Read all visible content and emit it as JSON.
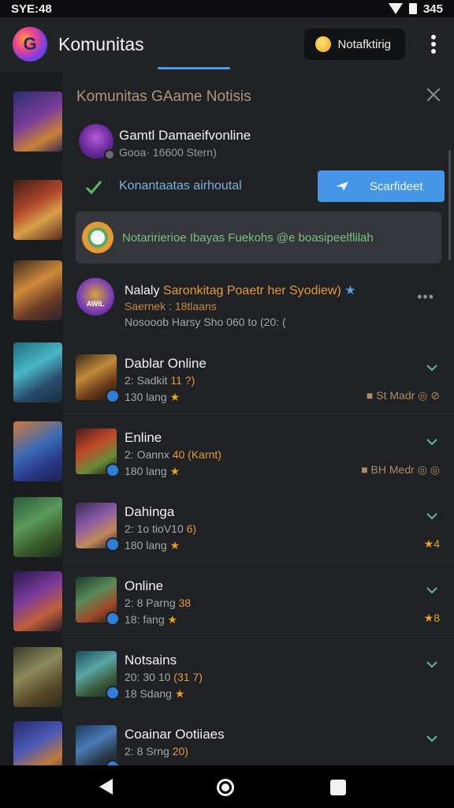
{
  "status_bar": {
    "time": "SYE:48",
    "right_time": "345"
  },
  "app_bar": {
    "title": "Komunitas",
    "notif_label": "Notafktirig"
  },
  "panel": {
    "title": "Komunitas GAame Notisis",
    "header": {
      "name": "Gamtl Damaeifvonline",
      "sub": "Gooa· 16600 Stern)"
    },
    "action": {
      "text": "Konantaatas airhoutal",
      "button": "Scarfideet"
    },
    "banner": {
      "text": "Notaririerioe Ibayas Fuekohs @e boasipeelflilah"
    },
    "featured": {
      "name_a": "Nalaly ",
      "name_b": "Saronkitag Poaetr her Syodiew)",
      "badge_text": "AWIL",
      "sub1": "Saernek : 18tlaans",
      "sub2": "Nosooob Harsy Sho 060 to (20: ("
    },
    "items": [
      {
        "name": "Dablar Online",
        "line2_a": "2: Sadkit ",
        "line2_b": "11 ?)",
        "line3_a": "130 lang ",
        "line3_b": "★",
        "right": "■ St Madr ◎ ⊘"
      },
      {
        "name": "Enline",
        "line2_a": "2: Oannx ",
        "line2_b": "40 (Karnt)",
        "line3_a": "180 lang ",
        "line3_b": "★",
        "right": "■ BH Medr ◎ ◎"
      },
      {
        "name": "Dahinga",
        "line2_a": "2: 1o tioV10 ",
        "line2_b": "6)",
        "line3_a": "180 lang ",
        "line3_b": "★",
        "right": "★4"
      },
      {
        "name": "Online",
        "line2_a": "2: 8 Parng ",
        "line2_b": "38",
        "line3_a": "18: fang ",
        "line3_b": "★",
        "right": "★8"
      },
      {
        "name": "Notsains",
        "line2_a": "20: 30 10 ",
        "line2_b": "(31 7)",
        "line3_a": "18 Sdang ",
        "line3_b": "★",
        "right": ""
      },
      {
        "name": "Coainar Ootiiaes",
        "line2_a": "2: 8 Srng ",
        "line2_b": "20)",
        "line3_a": "",
        "line3_b": "",
        "right": ""
      }
    ]
  },
  "colors": {
    "accent": "#4596e6",
    "background": "#202124",
    "highlight_orange": "#e39a3d",
    "banner_green": "#79c27a"
  },
  "icons": [
    "signal-icon",
    "battery-icon",
    "app-logo",
    "coin-icon",
    "kebab-menu-icon",
    "close-icon",
    "check-icon",
    "send-icon",
    "more-icon",
    "chevron-down-icon",
    "verified-icon",
    "back-icon",
    "home-icon",
    "recents-icon"
  ]
}
